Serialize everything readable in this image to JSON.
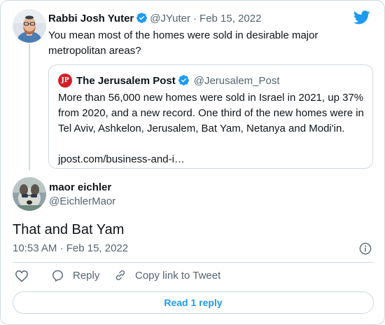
{
  "colors": {
    "accent": "#1d9bf0",
    "muted": "#536471",
    "text": "#0f1419",
    "border": "#cfd9de",
    "jpost_red": "#d32027"
  },
  "icons": {
    "platform": "twitter-bird-icon",
    "verified": "verified-badge-icon",
    "info": "info-icon",
    "like": "heart-icon",
    "reply": "reply-icon",
    "copy": "link-icon"
  },
  "parent_tweet": {
    "author_name": "Rabbi Josh Yuter",
    "handle": "@JYuter",
    "separator": "·",
    "date": "Feb 15, 2022",
    "text_line1": "You mean most of the homes were sold in desirable major",
    "text_line2": "metropolitan areas?"
  },
  "quoted_tweet": {
    "author_name": "The Jerusalem Post",
    "handle": "@Jerusalem_Post",
    "logo_text": "JP",
    "text_line1": "More than 56,000 new homes were sold in Israel in 2021, up 37%",
    "text_line2": "from 2020, and a new record. One third of the new homes were in",
    "text_line3": "Tel Aviv, Ashkelon, Jerusalem, Bat Yam, Netanya and Modi'in.",
    "link": "jpost.com/business-and-i…"
  },
  "main_tweet": {
    "author_name": "maor eichler",
    "handle": "@EichlerMaor",
    "text": "That and Bat Yam",
    "timestamp": "10:53 AM · Feb 15, 2022"
  },
  "actions": {
    "reply_label": "Reply",
    "copy_label": "Copy link to Tweet"
  },
  "read_replies_label": "Read 1 reply"
}
